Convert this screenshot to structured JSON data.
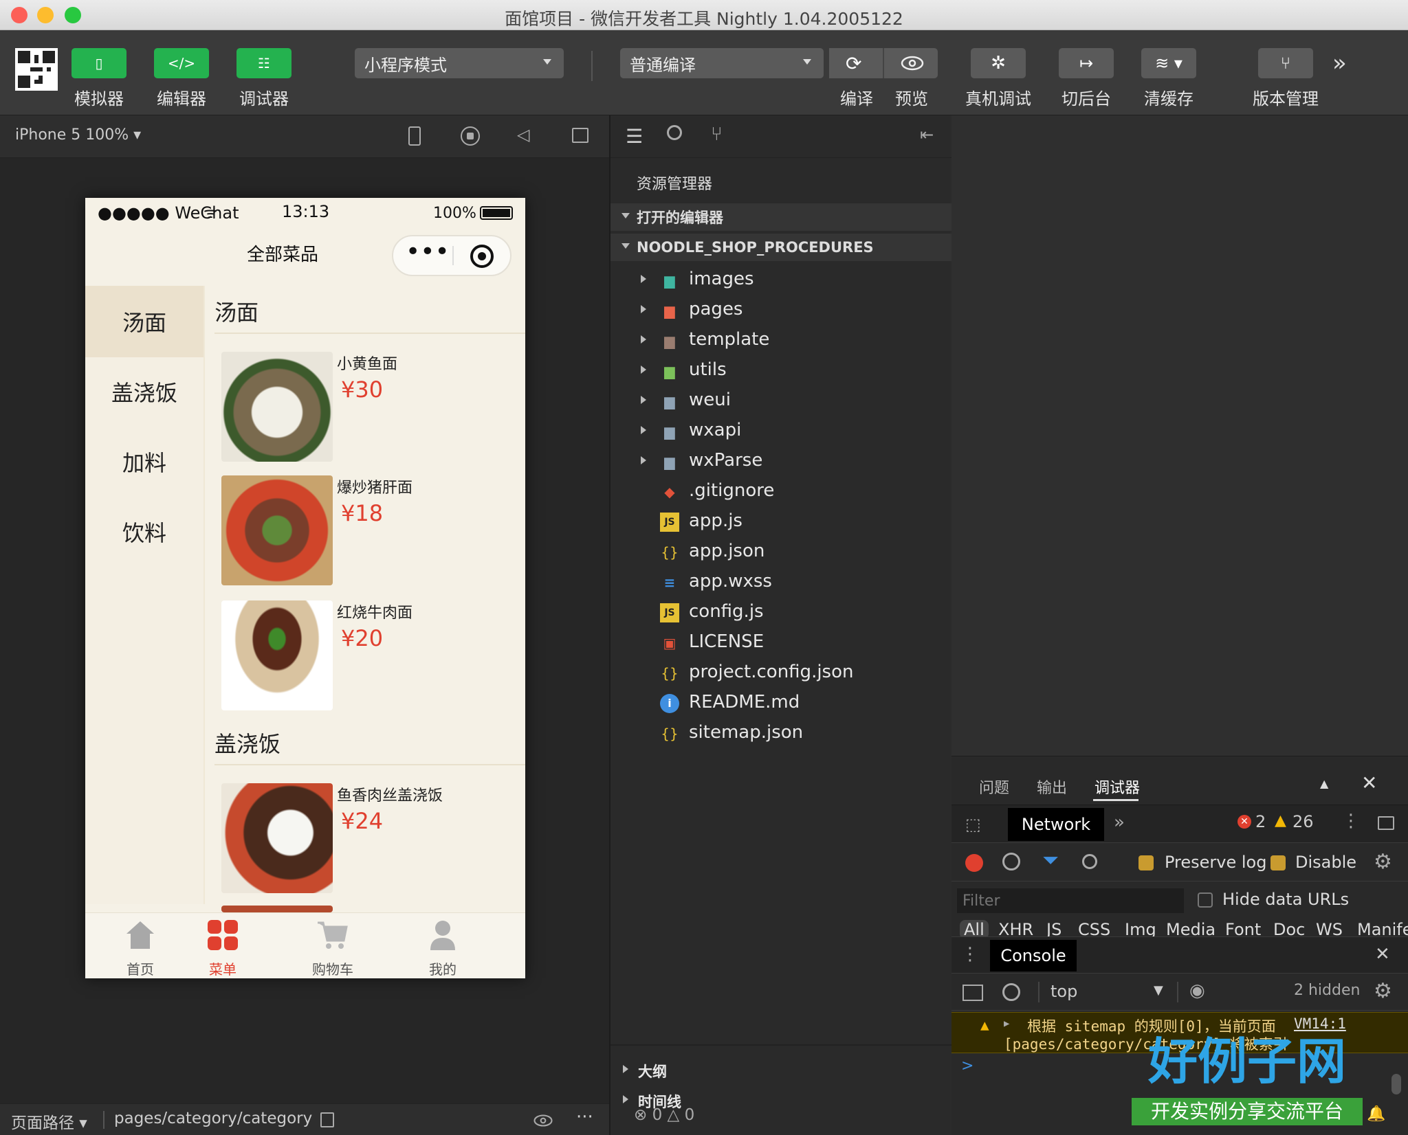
{
  "window": {
    "title": "面馆项目 - 微信开发者工具 Nightly 1.04.2005122"
  },
  "toolbar": {
    "simulator": "模拟器",
    "editor": "编辑器",
    "debugger": "调试器",
    "mode_select": "小程序模式",
    "compile_select": "普通编译",
    "compile": "编译",
    "preview": "预览",
    "remote_debug": "真机调试",
    "background": "切后台",
    "clear_cache": "清缓存",
    "version": "版本管理",
    "more": "»"
  },
  "simulator": {
    "device": "iPhone 5 100%",
    "status": {
      "carrier": "●●●●● WeChat",
      "time": "13:13",
      "battery": "100%"
    },
    "nav_title": "全部菜品",
    "capsule_dots": "•••",
    "categories": [
      "汤面",
      "盖浇饭",
      "加料",
      "饮料"
    ],
    "sections": [
      {
        "title": "汤面",
        "dishes": [
          {
            "name": "小黄鱼面",
            "price": "¥30"
          },
          {
            "name": "爆炒猪肝面",
            "price": "¥18"
          },
          {
            "name": "红烧牛肉面",
            "price": "¥20"
          }
        ]
      },
      {
        "title": "盖浇饭",
        "dishes": [
          {
            "name": "鱼香肉丝盖浇饭",
            "price": "¥24"
          }
        ]
      }
    ],
    "tabs": [
      "首页",
      "菜单",
      "购物车",
      "我的"
    ]
  },
  "pathbar": {
    "label": "页面路径",
    "path": "pages/category/category",
    "more": "···"
  },
  "explorer": {
    "title": "资源管理器",
    "open_editors": "打开的编辑器",
    "project": "NOODLE_SHOP_PROCEDURES",
    "folders": [
      "images",
      "pages",
      "template",
      "utils",
      "weui",
      "wxapi",
      "wxParse"
    ],
    "files": [
      ".gitignore",
      "app.js",
      "app.json",
      "app.wxss",
      "config.js",
      "LICENSE",
      "project.config.json",
      "README.md",
      "sitemap.json"
    ],
    "outline": "大纲",
    "timeline": "时间线",
    "status_errors": "0",
    "status_warnings": "0"
  },
  "devtools": {
    "tabs": [
      "问题",
      "输出",
      "调试器"
    ],
    "panel": "Network",
    "errors": "2",
    "warnings": "26",
    "preserve_log": "Preserve log",
    "disable_cache": "Disable",
    "filter_placeholder": "Filter",
    "hide_data_urls": "Hide data URLs",
    "types": [
      "All",
      "XHR",
      "JS",
      "CSS",
      "Img",
      "Media",
      "Font",
      "Doc",
      "WS",
      "Manife"
    ],
    "console": "Console",
    "context": "top",
    "hidden": "2 hidden",
    "message_line1": "根据 sitemap 的规则[0]，当前页面",
    "message_source": "VM14:1",
    "message_line2": "[pages/category/category] 将被索引",
    "prompt": ">"
  },
  "watermark": {
    "title": "好例子网",
    "subtitle": "开发实例分享交流平台"
  },
  "colors": {
    "green": "#24b24f",
    "price": "#e0402f",
    "tab_active": "#e0402f",
    "warning": "#f2b705"
  }
}
